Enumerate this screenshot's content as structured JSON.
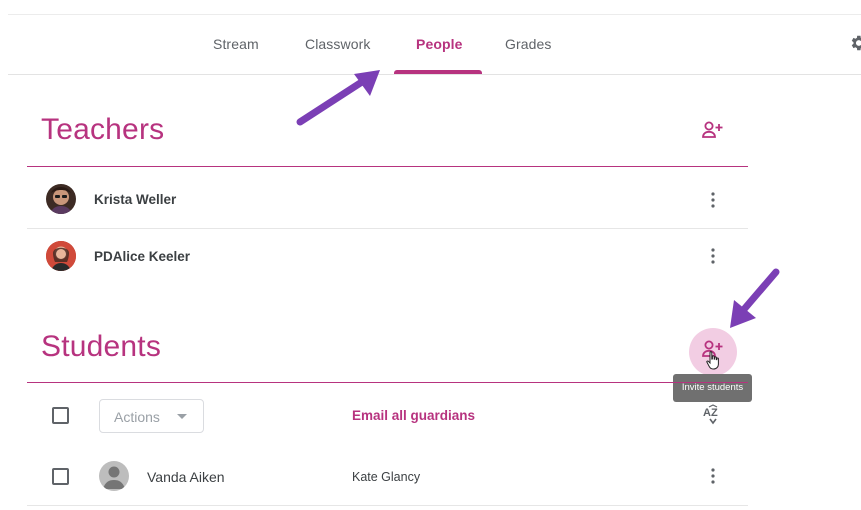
{
  "nav": {
    "tabs": [
      {
        "label": "Stream"
      },
      {
        "label": "Classwork"
      },
      {
        "label": "People"
      },
      {
        "label": "Grades"
      }
    ],
    "active_tab": "People",
    "accent_color": "#b7337f",
    "settings_icon": "gear-icon"
  },
  "teachers": {
    "title": "Teachers",
    "invite_icon": "person-add-icon",
    "list": [
      {
        "name": "Krista Weller"
      },
      {
        "name": "PDAlice Keeler"
      }
    ]
  },
  "students": {
    "title": "Students",
    "invite_icon": "person-add-icon",
    "tooltip": "Invite students",
    "actions_label": "Actions",
    "email_guardians_label": "Email all guardians",
    "sort_icon": "sort-az-icon",
    "list": [
      {
        "name": "Vanda Aiken",
        "guardian": "Kate Glancy"
      }
    ]
  },
  "annotation_color": "#7b3fb5"
}
